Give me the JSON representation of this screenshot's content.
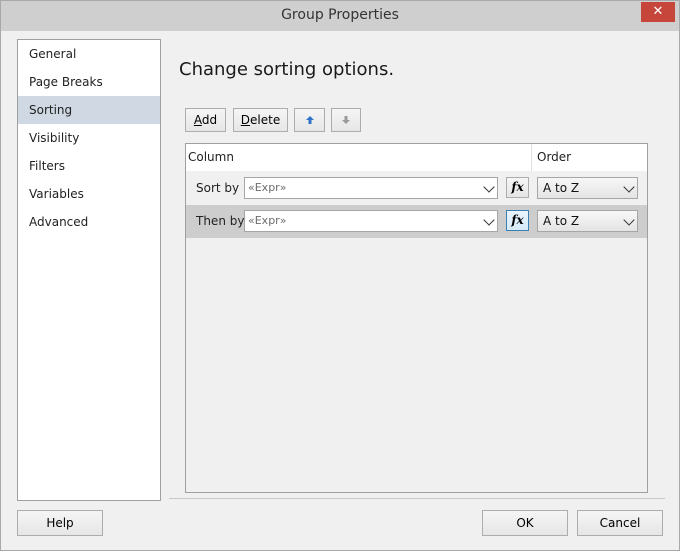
{
  "window": {
    "title": "Group Properties",
    "close_glyph": "✕"
  },
  "nav": {
    "items": [
      {
        "label": "General"
      },
      {
        "label": "Page Breaks"
      },
      {
        "label": "Sorting",
        "selected": true
      },
      {
        "label": "Visibility"
      },
      {
        "label": "Filters"
      },
      {
        "label": "Variables"
      },
      {
        "label": "Advanced"
      }
    ]
  },
  "main": {
    "heading": "Change sorting options.",
    "toolbar": {
      "add_label": "Add",
      "delete_label": "Delete",
      "move_up_icon": "arrow-up-icon",
      "move_down_icon": "arrow-down-icon"
    },
    "grid": {
      "headers": {
        "column": "Column",
        "order": "Order"
      },
      "rows": [
        {
          "label": "Sort by",
          "expression": "«Expr»",
          "order": "A to Z"
        },
        {
          "label": "Then by",
          "expression": "«Expr»",
          "order": "A to Z"
        }
      ]
    }
  },
  "footer": {
    "help_label": "Help",
    "ok_label": "OK",
    "cancel_label": "Cancel"
  },
  "colors": {
    "selected_nav": "#cfd8e3",
    "close_button": "#c7463b",
    "selected_row": "#cdcdcd"
  }
}
